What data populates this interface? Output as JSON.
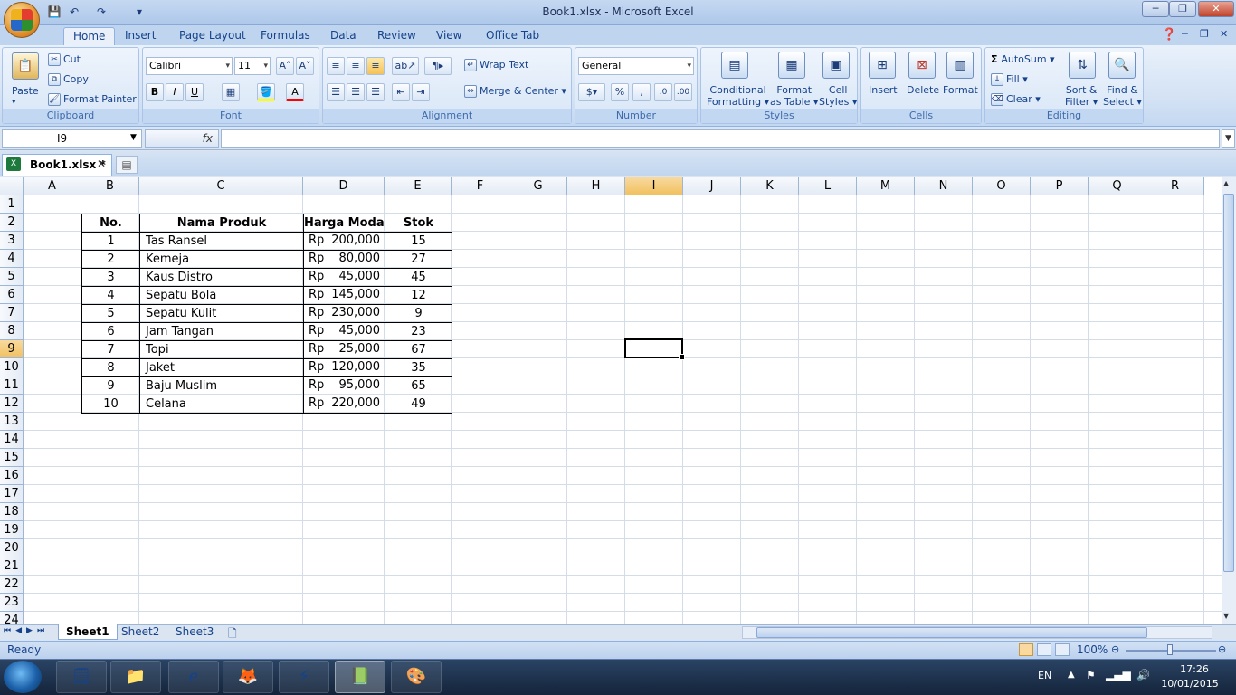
{
  "window": {
    "title": "Book1.xlsx - Microsoft Excel"
  },
  "ribbon_tabs": [
    "Home",
    "Insert",
    "Page Layout",
    "Formulas",
    "Data",
    "Review",
    "View",
    "Office Tab"
  ],
  "clipboard": {
    "paste": "Paste",
    "cut": "Cut",
    "copy": "Copy",
    "format_painter": "Format Painter",
    "label": "Clipboard"
  },
  "font": {
    "name": "Calibri",
    "size": "11",
    "bold": "B",
    "italic": "I",
    "underline": "U",
    "label": "Font"
  },
  "alignment": {
    "wrap_text": "Wrap Text",
    "merge_center": "Merge & Center",
    "label": "Alignment"
  },
  "number": {
    "format": "General",
    "label": "Number"
  },
  "styles": {
    "conditional_1": "Conditional",
    "conditional_2": "Formatting",
    "table_1": "Format",
    "table_2": "as Table",
    "cell_1": "Cell",
    "cell_2": "Styles",
    "label": "Styles"
  },
  "cells": {
    "insert": "Insert",
    "delete": "Delete",
    "format": "Format",
    "label": "Cells"
  },
  "editing": {
    "autosum": "AutoSum",
    "fill": "Fill",
    "clear": "Clear",
    "sort_1": "Sort &",
    "sort_2": "Filter",
    "find_1": "Find &",
    "find_2": "Select",
    "label": "Editing"
  },
  "formula_bar": {
    "name_box": "I9",
    "fx": "fx",
    "formula": ""
  },
  "doc_tab": {
    "name": "Book1.xlsx *"
  },
  "columns": [
    "A",
    "B",
    "C",
    "D",
    "E",
    "F",
    "G",
    "H",
    "I",
    "J",
    "K",
    "L",
    "M",
    "N",
    "O",
    "P",
    "Q",
    "R"
  ],
  "rows": [
    "1",
    "2",
    "3",
    "4",
    "5",
    "6",
    "7",
    "8",
    "9",
    "10",
    "11",
    "12",
    "13",
    "14",
    "15",
    "16",
    "17",
    "18",
    "19",
    "20",
    "21",
    "22",
    "23",
    "24"
  ],
  "table": {
    "headers": [
      "No.",
      "Nama Produk",
      "Harga Modal",
      "Stok"
    ],
    "rows": [
      {
        "no": "1",
        "produk": "Tas Ransel",
        "cur": "Rp",
        "harga": "200,000",
        "stok": "15"
      },
      {
        "no": "2",
        "produk": "Kemeja",
        "cur": "Rp",
        "harga": "80,000",
        "stok": "27"
      },
      {
        "no": "3",
        "produk": "Kaus Distro",
        "cur": "Rp",
        "harga": "45,000",
        "stok": "45"
      },
      {
        "no": "4",
        "produk": "Sepatu Bola",
        "cur": "Rp",
        "harga": "145,000",
        "stok": "12"
      },
      {
        "no": "5",
        "produk": "Sepatu Kulit",
        "cur": "Rp",
        "harga": "230,000",
        "stok": "9"
      },
      {
        "no": "6",
        "produk": "Jam Tangan",
        "cur": "Rp",
        "harga": "45,000",
        "stok": "23"
      },
      {
        "no": "7",
        "produk": "Topi",
        "cur": "Rp",
        "harga": "25,000",
        "stok": "67"
      },
      {
        "no": "8",
        "produk": "Jaket",
        "cur": "Rp",
        "harga": "120,000",
        "stok": "35"
      },
      {
        "no": "9",
        "produk": "Baju Muslim",
        "cur": "Rp",
        "harga": "95,000",
        "stok": "65"
      },
      {
        "no": "10",
        "produk": "Celana",
        "cur": "Rp",
        "harga": "220,000",
        "stok": "49"
      }
    ]
  },
  "sheets": [
    "Sheet1",
    "Sheet2",
    "Sheet3"
  ],
  "status": {
    "mode": "Ready",
    "zoom": "100%"
  },
  "taskbar": {
    "lang": "EN",
    "time": "17:26",
    "date": "10/01/2015"
  }
}
